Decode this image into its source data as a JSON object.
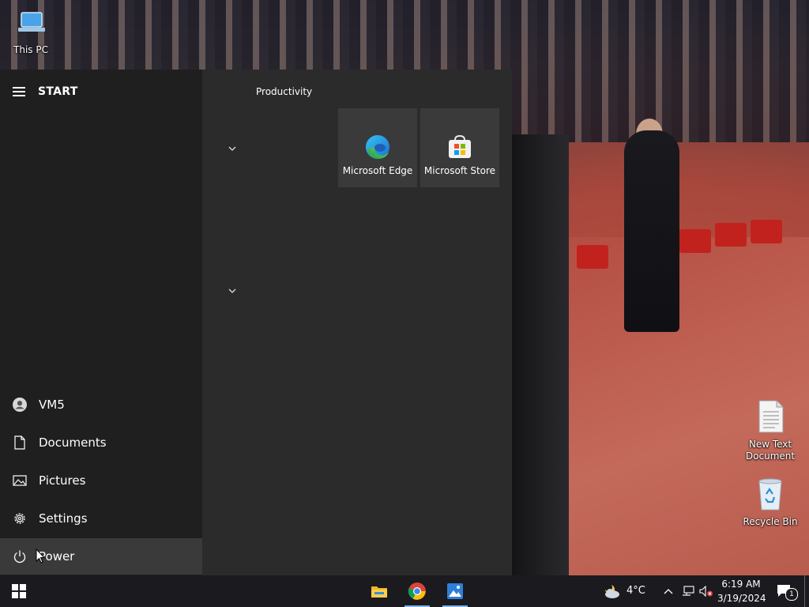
{
  "desktop": {
    "icons": [
      {
        "label": "This PC",
        "icon": "computer-icon"
      },
      {
        "label": "New Text Document",
        "icon": "text-file-icon"
      },
      {
        "label": "Recycle Bin",
        "icon": "recycle-bin-icon"
      }
    ]
  },
  "start_menu": {
    "title": "START",
    "left_items": [
      {
        "label": "VM5",
        "icon": "user-icon"
      },
      {
        "label": "Documents",
        "icon": "document-icon"
      },
      {
        "label": "Pictures",
        "icon": "picture-icon"
      },
      {
        "label": "Settings",
        "icon": "gear-icon"
      },
      {
        "label": "Power",
        "icon": "power-icon"
      }
    ],
    "group_title": "Productivity",
    "tiles": [
      {
        "label": "Microsoft Edge",
        "icon": "edge-icon"
      },
      {
        "label": "Microsoft Store",
        "icon": "store-icon"
      }
    ]
  },
  "taskbar": {
    "pinned": [
      {
        "name": "File Explorer",
        "icon": "folder-icon"
      },
      {
        "name": "Google Chrome",
        "icon": "chrome-icon"
      },
      {
        "name": "Photos",
        "icon": "photos-icon"
      }
    ],
    "weather": {
      "temp": "4°C",
      "icon": "weather-cloud-moon-icon"
    },
    "clock": {
      "time": "6:19 AM",
      "date": "3/19/2024"
    },
    "notifications_count": "1"
  },
  "colors": {
    "accent": "#7fb2e6",
    "start_left_bg": "#1f1f1f",
    "start_right_bg": "#2b2b2b",
    "tile_bg": "#3a3a3a",
    "taskbar_bg": "#1a1a1f"
  }
}
